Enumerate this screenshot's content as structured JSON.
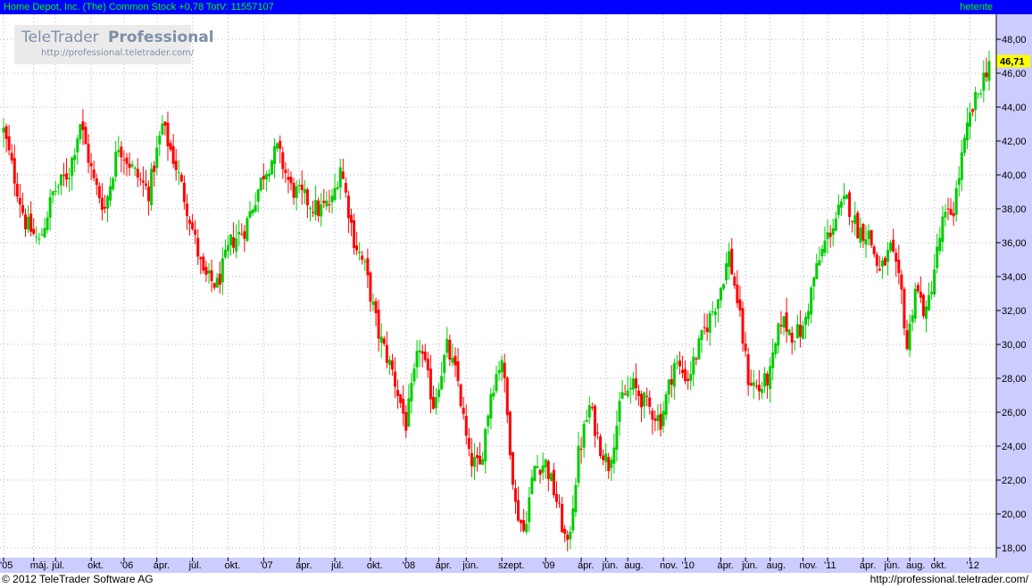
{
  "header": {
    "title": "Home Depot, Inc. (The) Common Stock +0,78 TotV: 11557107",
    "period": "hetente"
  },
  "watermark": {
    "brand_a": "TeleTrader",
    "brand_b": "Professional",
    "url": "http://professional.teletrader.com/"
  },
  "footer": {
    "copyright": "© 2012 TeleTrader Software AG",
    "url": "http://professional.teletrader.com/"
  },
  "colors": {
    "up": "#00cc00",
    "down": "#ff0000",
    "title_bar": "#0000ff",
    "title_text": "#00ff00",
    "axis_band": "#ccccff",
    "last_price_bg": "#ffff00"
  },
  "chart_data": {
    "type": "candlestick",
    "interval": "weekly",
    "last_price": "46,71",
    "y_ticks": [
      "18,00",
      "20,00",
      "22,00",
      "24,00",
      "26,00",
      "28,00",
      "30,00",
      "32,00",
      "34,00",
      "36,00",
      "38,00",
      "40,00",
      "42,00",
      "44,00",
      "46,00",
      "48,00"
    ],
    "ylim": [
      17,
      49
    ],
    "x_tick_labels": [
      {
        "label": "'05",
        "t": 0
      },
      {
        "label": "máj.",
        "t": 11
      },
      {
        "label": "júl.",
        "t": 19
      },
      {
        "label": "okt.",
        "t": 32
      },
      {
        "label": "'06",
        "t": 44
      },
      {
        "label": "ápr.",
        "t": 56
      },
      {
        "label": "júl.",
        "t": 69
      },
      {
        "label": "okt.",
        "t": 82
      },
      {
        "label": "'07",
        "t": 95
      },
      {
        "label": "ápr.",
        "t": 108
      },
      {
        "label": "júl.",
        "t": 121
      },
      {
        "label": "okt.",
        "t": 134
      },
      {
        "label": "'08",
        "t": 147
      },
      {
        "label": "ápr.",
        "t": 159
      },
      {
        "label": "jún.",
        "t": 169
      },
      {
        "label": "szept.",
        "t": 182
      },
      {
        "label": "'09",
        "t": 198
      },
      {
        "label": "ápr.",
        "t": 211
      },
      {
        "label": "jún.",
        "t": 220
      },
      {
        "label": "aug.",
        "t": 228
      },
      {
        "label": "nov.",
        "t": 241
      },
      {
        "label": "'10",
        "t": 249
      },
      {
        "label": "ápr.",
        "t": 262
      },
      {
        "label": "jún.",
        "t": 271
      },
      {
        "label": "aug.",
        "t": 280
      },
      {
        "label": "nov.",
        "t": 292
      },
      {
        "label": "'11",
        "t": 301
      },
      {
        "label": "ápr.",
        "t": 314
      },
      {
        "label": "jún.",
        "t": 323
      },
      {
        "label": "aug.",
        "t": 331
      },
      {
        "label": "okt.",
        "t": 340
      },
      {
        "label": "'12",
        "t": 353
      }
    ],
    "weeks": 361,
    "close_path": [
      [
        0,
        42.6
      ],
      [
        3,
        40.5
      ],
      [
        8,
        37.2
      ],
      [
        13,
        36.0
      ],
      [
        18,
        38.9
      ],
      [
        24,
        40.2
      ],
      [
        28,
        43.1
      ],
      [
        33,
        39.6
      ],
      [
        37,
        38.0
      ],
      [
        42,
        41.8
      ],
      [
        48,
        40.1
      ],
      [
        53,
        39.0
      ],
      [
        58,
        42.9
      ],
      [
        63,
        40.5
      ],
      [
        68,
        37.5
      ],
      [
        73,
        34.0
      ],
      [
        78,
        33.5
      ],
      [
        83,
        36.0
      ],
      [
        88,
        36.8
      ],
      [
        95,
        40.1
      ],
      [
        100,
        41.5
      ],
      [
        105,
        39.2
      ],
      [
        110,
        38.6
      ],
      [
        115,
        37.9
      ],
      [
        120,
        38.4
      ],
      [
        123,
        40.6
      ],
      [
        128,
        36.2
      ],
      [
        132,
        34.5
      ],
      [
        137,
        30.6
      ],
      [
        142,
        28.4
      ],
      [
        147,
        25.3
      ],
      [
        152,
        30.0
      ],
      [
        157,
        26.5
      ],
      [
        162,
        29.8
      ],
      [
        166,
        27.8
      ],
      [
        170,
        23.3
      ],
      [
        174,
        22.7
      ],
      [
        178,
        27.2
      ],
      [
        182,
        29.3
      ],
      [
        187,
        20.5
      ],
      [
        190,
        19.0
      ],
      [
        194,
        22.8
      ],
      [
        198,
        23.0
      ],
      [
        202,
        20.8
      ],
      [
        206,
        17.9
      ],
      [
        210,
        23.5
      ],
      [
        214,
        26.3
      ],
      [
        218,
        24.0
      ],
      [
        221,
        22.9
      ],
      [
        226,
        26.9
      ],
      [
        230,
        27.5
      ],
      [
        235,
        26.4
      ],
      [
        240,
        25.5
      ],
      [
        245,
        28.9
      ],
      [
        250,
        28.0
      ],
      [
        256,
        30.8
      ],
      [
        261,
        32.8
      ],
      [
        265,
        35.3
      ],
      [
        268,
        32.6
      ],
      [
        272,
        28.0
      ],
      [
        276,
        27.3
      ],
      [
        280,
        28.2
      ],
      [
        284,
        31.5
      ],
      [
        288,
        30.6
      ],
      [
        292,
        30.8
      ],
      [
        296,
        33.9
      ],
      [
        300,
        36.0
      ],
      [
        305,
        37.8
      ],
      [
        308,
        38.5
      ],
      [
        312,
        36.8
      ],
      [
        316,
        36.5
      ],
      [
        320,
        34.2
      ],
      [
        324,
        35.6
      ],
      [
        328,
        33.0
      ],
      [
        330,
        29.8
      ],
      [
        333,
        33.4
      ],
      [
        337,
        31.7
      ],
      [
        340,
        34.5
      ],
      [
        343,
        37.2
      ],
      [
        347,
        38.0
      ],
      [
        350,
        41.0
      ],
      [
        353,
        43.4
      ],
      [
        357,
        45.3
      ],
      [
        360,
        46.7
      ]
    ]
  }
}
